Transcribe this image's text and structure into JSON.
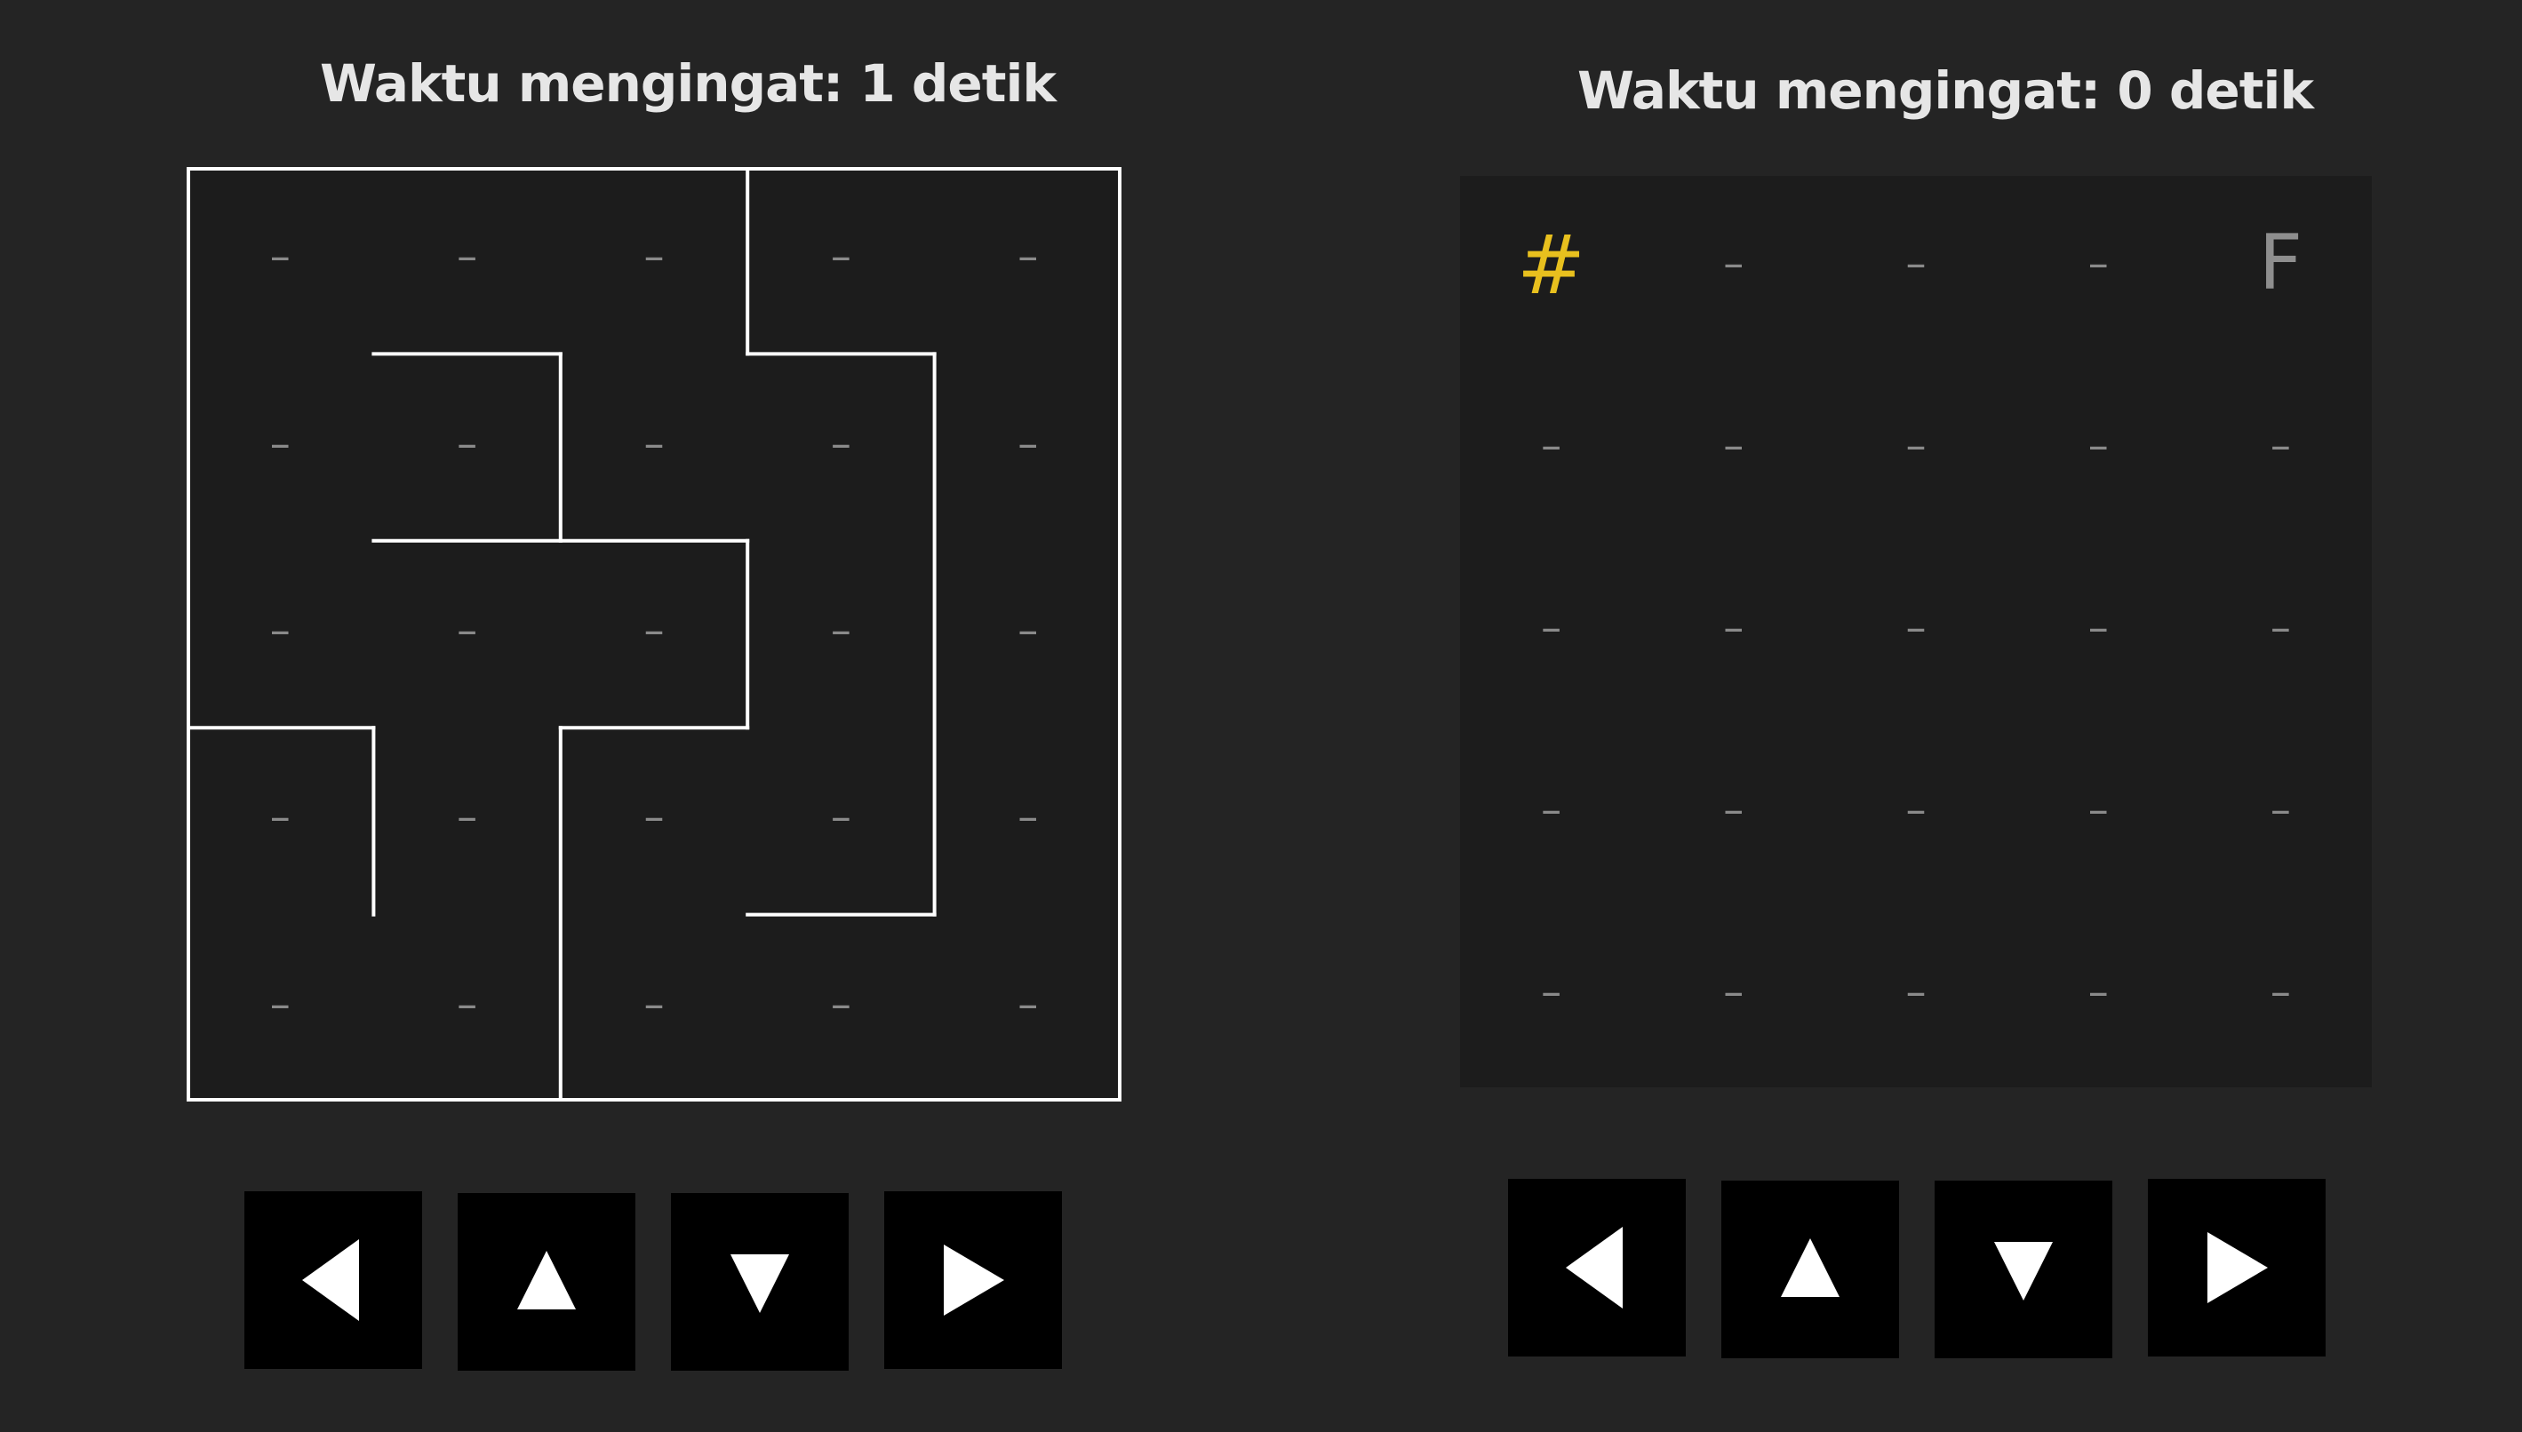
{
  "left_panel": {
    "title": "Waktu mengingat: 1 detik",
    "grid_size": 5,
    "cell_symbols": [
      [
        "–",
        "–",
        "–",
        "–",
        "–"
      ],
      [
        "–",
        "–",
        "–",
        "–",
        "–"
      ],
      [
        "–",
        "–",
        "–",
        "–",
        "–"
      ],
      [
        "–",
        "–",
        "–",
        "–",
        "–"
      ],
      [
        "–",
        "–",
        "–",
        "–",
        "–"
      ]
    ],
    "walls": [
      [
        [
          3,
          0
        ],
        [
          3,
          1
        ]
      ],
      [
        [
          3,
          1
        ],
        [
          4,
          1
        ]
      ],
      [
        [
          4,
          1
        ],
        [
          4,
          4
        ]
      ],
      [
        [
          4,
          4
        ],
        [
          3,
          4
        ]
      ],
      [
        [
          1,
          1
        ],
        [
          2,
          1
        ]
      ],
      [
        [
          2,
          1
        ],
        [
          2,
          2
        ]
      ],
      [
        [
          1,
          2
        ],
        [
          3,
          2
        ]
      ],
      [
        [
          3,
          2
        ],
        [
          3,
          3
        ]
      ],
      [
        [
          3,
          3
        ],
        [
          2,
          3
        ]
      ],
      [
        [
          2,
          3
        ],
        [
          2,
          5
        ]
      ],
      [
        [
          0,
          3
        ],
        [
          1,
          3
        ]
      ],
      [
        [
          1,
          3
        ],
        [
          1,
          4
        ]
      ]
    ],
    "controls": [
      "left-arrow-icon",
      "up-arrow-icon",
      "down-arrow-icon",
      "right-arrow-icon"
    ]
  },
  "right_panel": {
    "title": "Waktu mengingat: 0 detik",
    "grid_size": 5,
    "cell_symbols": [
      [
        "#",
        "–",
        "–",
        "–",
        "F"
      ],
      [
        "–",
        "–",
        "–",
        "–",
        "–"
      ],
      [
        "–",
        "–",
        "–",
        "–",
        "–"
      ],
      [
        "–",
        "–",
        "–",
        "–",
        "–"
      ],
      [
        "–",
        "–",
        "–",
        "–",
        "–"
      ]
    ],
    "player_symbol": "#",
    "finish_symbol": "F",
    "controls": [
      "left-arrow-icon",
      "up-arrow-icon",
      "down-arrow-icon",
      "right-arrow-icon"
    ]
  },
  "colors": {
    "background": "#242424",
    "board": "#1c1c1c",
    "wall": "#ffffff",
    "cell_marker": "#8a8a8a",
    "player": "#e8c01e",
    "finish": "#8e8e8e",
    "button": "#000000",
    "arrow": "#ffffff"
  }
}
